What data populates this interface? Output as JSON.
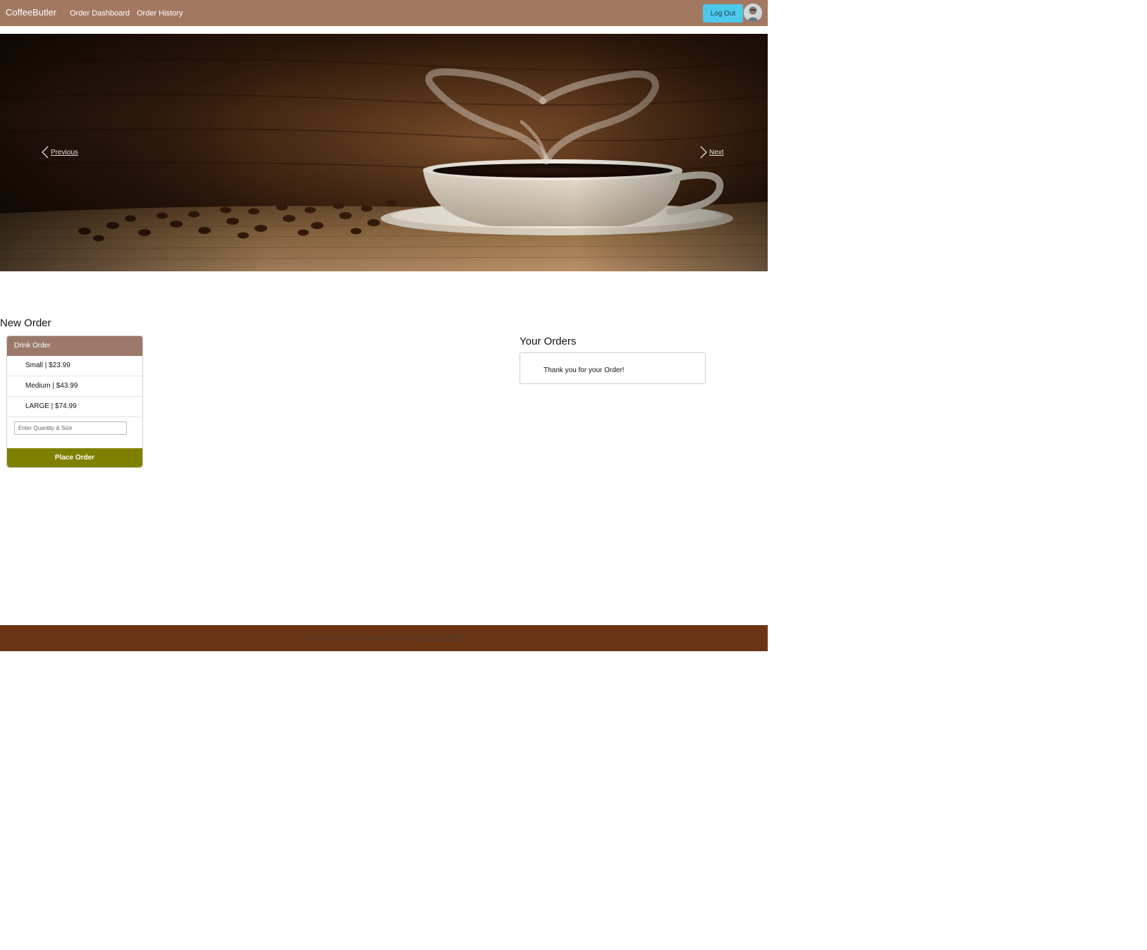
{
  "navbar": {
    "brand": "CoffeeButler",
    "links": [
      "Order Dashboard",
      "Order History"
    ],
    "logout_label": "Log Out"
  },
  "carousel": {
    "prev_label": "Previous",
    "next_label": "Next"
  },
  "new_order": {
    "title": "New Order",
    "card_header": "Drink Order",
    "sizes": [
      "Small | $23.99",
      "Medium | $43.99",
      "LARGE | $74.99"
    ],
    "input_placeholder": "Enter Quantity & Size",
    "submit_label": "Place Order"
  },
  "your_orders": {
    "title": "Your Orders",
    "message": "Thank you for your Order!"
  },
  "footer": {
    "text": "© 2023 GA Tech BootCamp Cohort: ",
    "link_label": "TEAM AAMMO"
  },
  "colors": {
    "navbar": "#a27860",
    "logout_button": "#4cc9ea",
    "card_header": "#9b786a",
    "place_order_button": "#808000",
    "footer": "#6b3515"
  },
  "icons": [
    "chevron-left-icon",
    "chevron-right-icon",
    "avatar"
  ]
}
